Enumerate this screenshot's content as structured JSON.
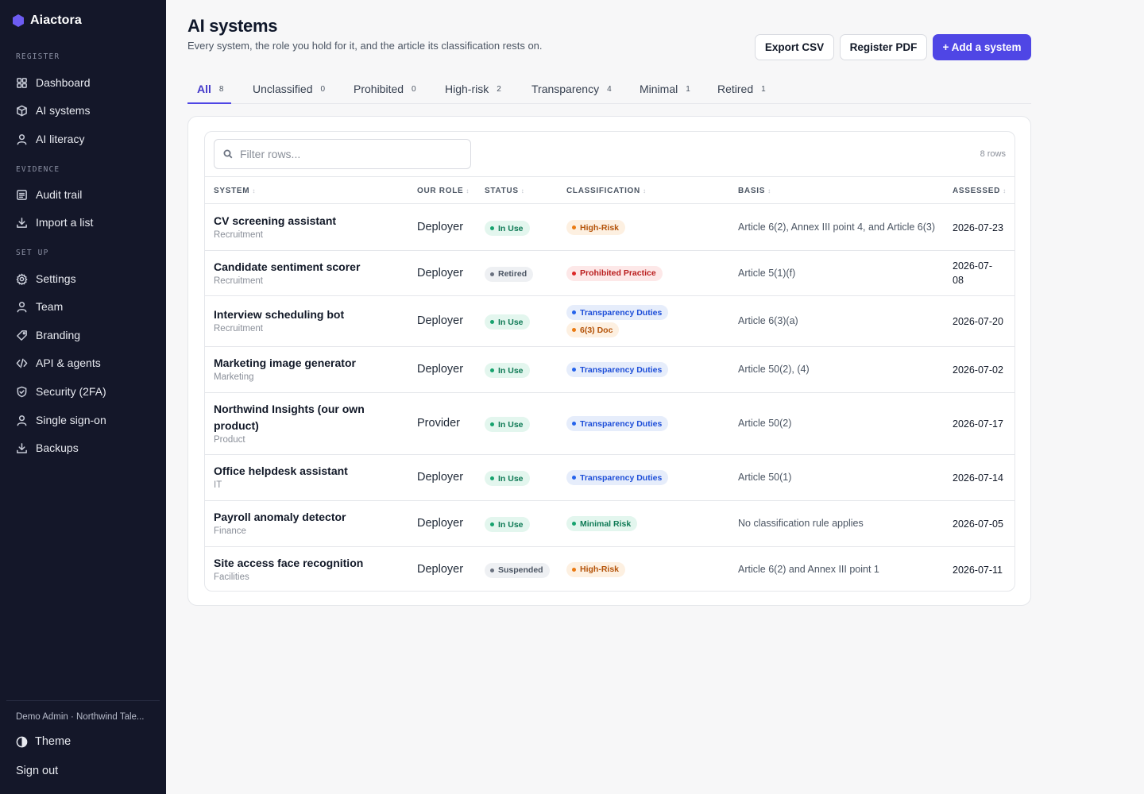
{
  "app": {
    "name": "Aiactora",
    "accent": "#4f46e5"
  },
  "sidebar": {
    "sections": [
      {
        "title": "REGISTER",
        "items": [
          {
            "label": "Dashboard",
            "icon": "dashboard-icon"
          },
          {
            "label": "AI systems",
            "icon": "cube-icon"
          },
          {
            "label": "AI literacy",
            "icon": "user-icon"
          }
        ]
      },
      {
        "title": "EVIDENCE",
        "items": [
          {
            "label": "Audit trail",
            "icon": "list-icon"
          },
          {
            "label": "Import a list",
            "icon": "download-icon"
          }
        ]
      },
      {
        "title": "SET UP",
        "items": [
          {
            "label": "Settings",
            "icon": "gear-icon"
          },
          {
            "label": "Team",
            "icon": "user-icon"
          },
          {
            "label": "Branding",
            "icon": "tag-icon"
          },
          {
            "label": "API & agents",
            "icon": "code-icon"
          },
          {
            "label": "Security (2FA)",
            "icon": "shield-icon"
          },
          {
            "label": "Single sign-on",
            "icon": "user-icon"
          },
          {
            "label": "Backups",
            "icon": "download-icon"
          }
        ]
      }
    ],
    "user": "Demo Admin · Northwind Tale...",
    "theme_label": "Theme",
    "signout_label": "Sign out"
  },
  "header": {
    "title": "AI systems",
    "subtitle": "Every system, the role you hold for it, and the article its classification rests on.",
    "export_csv": "Export CSV",
    "register_pdf": "Register PDF",
    "add_system": "+ Add a system"
  },
  "tabs": [
    {
      "label": "All",
      "count": "8",
      "active": true
    },
    {
      "label": "Unclassified",
      "count": "0"
    },
    {
      "label": "Prohibited",
      "count": "0"
    },
    {
      "label": "High-risk",
      "count": "2"
    },
    {
      "label": "Transparency",
      "count": "4"
    },
    {
      "label": "Minimal",
      "count": "1"
    },
    {
      "label": "Retired",
      "count": "1"
    }
  ],
  "table": {
    "search_placeholder": "Filter rows...",
    "row_count": "8 rows",
    "columns": [
      "SYSTEM",
      "OUR ROLE",
      "STATUS",
      "CLASSIFICATION",
      "BASIS",
      "ASSESSED"
    ],
    "rows": [
      {
        "name": "CV screening assistant",
        "dept": "Recruitment",
        "role": "Deployer",
        "status": "In Use",
        "classes": [
          {
            "label": "High-Risk",
            "kind": "high"
          }
        ],
        "basis": "Article 6(2), Annex III point 4, and Article 6(3)",
        "assessed": "2026-07-23"
      },
      {
        "name": "Candidate sentiment scorer",
        "dept": "Recruitment",
        "role": "Deployer",
        "status": "Retired",
        "classes": [
          {
            "label": "Prohibited Practice",
            "kind": "prohibited"
          }
        ],
        "basis": "Article 5(1)(f)",
        "assessed": "2026-07-08"
      },
      {
        "name": "Interview scheduling bot",
        "dept": "Recruitment",
        "role": "Deployer",
        "status": "In Use",
        "classes": [
          {
            "label": "Transparency Duties",
            "kind": "transparency"
          },
          {
            "label": "6(3) Doc",
            "kind": "high"
          }
        ],
        "basis": "Article 6(3)(a)",
        "assessed": "2026-07-20"
      },
      {
        "name": "Marketing image generator",
        "dept": "Marketing",
        "role": "Deployer",
        "status": "In Use",
        "classes": [
          {
            "label": "Transparency Duties",
            "kind": "transparency"
          }
        ],
        "basis": "Article 50(2), (4)",
        "assessed": "2026-07-02"
      },
      {
        "name": "Northwind Insights (our own product)",
        "dept": "Product",
        "role": "Provider",
        "status": "In Use",
        "classes": [
          {
            "label": "Transparency Duties",
            "kind": "transparency"
          }
        ],
        "basis": "Article 50(2)",
        "assessed": "2026-07-17"
      },
      {
        "name": "Office helpdesk assistant",
        "dept": "IT",
        "role": "Deployer",
        "status": "In Use",
        "classes": [
          {
            "label": "Transparency Duties",
            "kind": "transparency"
          }
        ],
        "basis": "Article 50(1)",
        "assessed": "2026-07-14"
      },
      {
        "name": "Payroll anomaly detector",
        "dept": "Finance",
        "role": "Deployer",
        "status": "In Use",
        "classes": [
          {
            "label": "Minimal Risk",
            "kind": "minimal"
          }
        ],
        "basis": "No classification rule applies",
        "assessed": "2026-07-05"
      },
      {
        "name": "Site access face recognition",
        "dept": "Facilities",
        "role": "Deployer",
        "status": "Suspended",
        "classes": [
          {
            "label": "High-Risk",
            "kind": "high"
          }
        ],
        "basis": "Article 6(2) and Annex III point 1",
        "assessed": "2026-07-11"
      }
    ]
  },
  "colors": {
    "status": {
      "In Use": {
        "bg": "#e3f6ee",
        "fg": "#0f7a55",
        "dot": "#16a36e"
      },
      "Retired": {
        "bg": "#eef0f3",
        "fg": "#4b5563",
        "dot": "#6b7280"
      },
      "Suspended": {
        "bg": "#eef0f3",
        "fg": "#4b5563",
        "dot": "#6b7280"
      }
    },
    "class": {
      "high": {
        "bg": "#fdf0e1",
        "fg": "#b45309",
        "dot": "#ea7a12"
      },
      "prohibited": {
        "bg": "#fde8e8",
        "fg": "#b91c1c",
        "dot": "#dc2626"
      },
      "transparency": {
        "bg": "#e6edfb",
        "fg": "#1d4ed8",
        "dot": "#2563eb"
      },
      "minimal": {
        "bg": "#e3f6ee",
        "fg": "#0f7a55",
        "dot": "#16a36e"
      }
    }
  }
}
